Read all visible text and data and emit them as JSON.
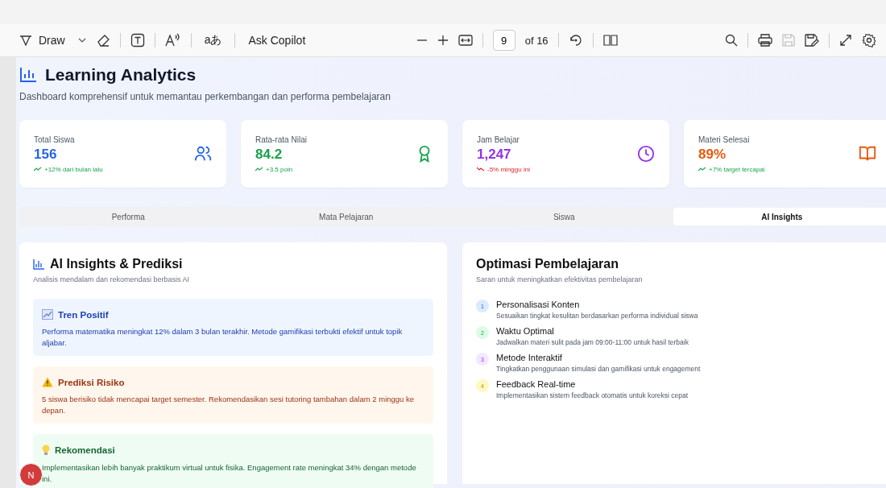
{
  "toolbar": {
    "draw_label": "Draw",
    "translate_label": "aあ",
    "copilot_label": "Ask Copilot",
    "page_value": "9",
    "page_total": "of 16",
    "save_disabled": true
  },
  "header": {
    "title": "Learning Analytics",
    "subtitle": "Dashboard komprehensif untuk memantau perkembangan dan performa pembelajaran"
  },
  "stats": [
    {
      "label": "Total Siswa",
      "value": "156",
      "trend": "+12% dari bulan lalu",
      "falling": false,
      "kind": "users",
      "color": "#2563eb"
    },
    {
      "label": "Rata-rata Nilai",
      "value": "84.2",
      "trend": "+3.5 poin",
      "falling": false,
      "kind": "award",
      "color": "#16a34a"
    },
    {
      "label": "Jam Belajar",
      "value": "1,247",
      "trend": "-5% minggu ini",
      "falling": true,
      "kind": "clock",
      "color": "#9333ea"
    },
    {
      "label": "Materi Selesai",
      "value": "89%",
      "trend": "+7% target tercapai",
      "falling": false,
      "kind": "book",
      "color": "#ea580c"
    }
  ],
  "tabs": [
    {
      "label": "Performa",
      "selected": false
    },
    {
      "label": "Mata Pelajaran",
      "selected": false
    },
    {
      "label": "Siswa",
      "selected": false
    },
    {
      "label": "AI Insights",
      "selected": true
    }
  ],
  "insights_panel": {
    "title": "AI Insights & Prediksi",
    "subtitle": "Analisis mendalam dan rekomendasi berbasis AI",
    "items": [
      {
        "kind": "positive",
        "title": "Tren Positif",
        "text": "Performa matematika meningkat 12% dalam 3 bulan terakhir. Metode gamifikasi terbukti efektif untuk topik aljabar."
      },
      {
        "kind": "risk",
        "title": "Prediksi Risiko",
        "text": "5 siswa berisiko tidak mencapai target semester. Rekomendasikan sesi tutoring tambahan dalam 2 minggu ke depan."
      },
      {
        "kind": "recommend",
        "title": "Rekomendasi",
        "text": "Implementasikan lebih banyak praktikum virtual untuk fisika. Engagement rate meningkat 34% dengan metode ini."
      }
    ]
  },
  "optimization_panel": {
    "title": "Optimasi Pembelajaran",
    "subtitle": "Saran untuk meningkatkan efektivitas pembelajaran",
    "items": [
      {
        "number": "1",
        "title": "Personalisasi Konten",
        "text": "Sesuaikan tingkat kesulitan berdasarkan performa individual siswa",
        "color": "#dbeafe"
      },
      {
        "number": "2",
        "title": "Waktu Optimal",
        "text": "Jadwalkan materi sulit pada jam 09:00-11:00 untuk hasil terbaik",
        "color": "#dcfce7"
      },
      {
        "number": "3",
        "title": "Metode Interaktif",
        "text": "Tingkatkan penggunaan simulasi dan gamifikasi untuk engagement",
        "color": "#f3e8ff"
      },
      {
        "number": "4",
        "title": "Feedback Real-time",
        "text": "Implementasikan sistem feedback otomatis untuk koreksi cepat",
        "color": "#fef9c3"
      }
    ]
  },
  "avatar": {
    "initial": "N"
  }
}
